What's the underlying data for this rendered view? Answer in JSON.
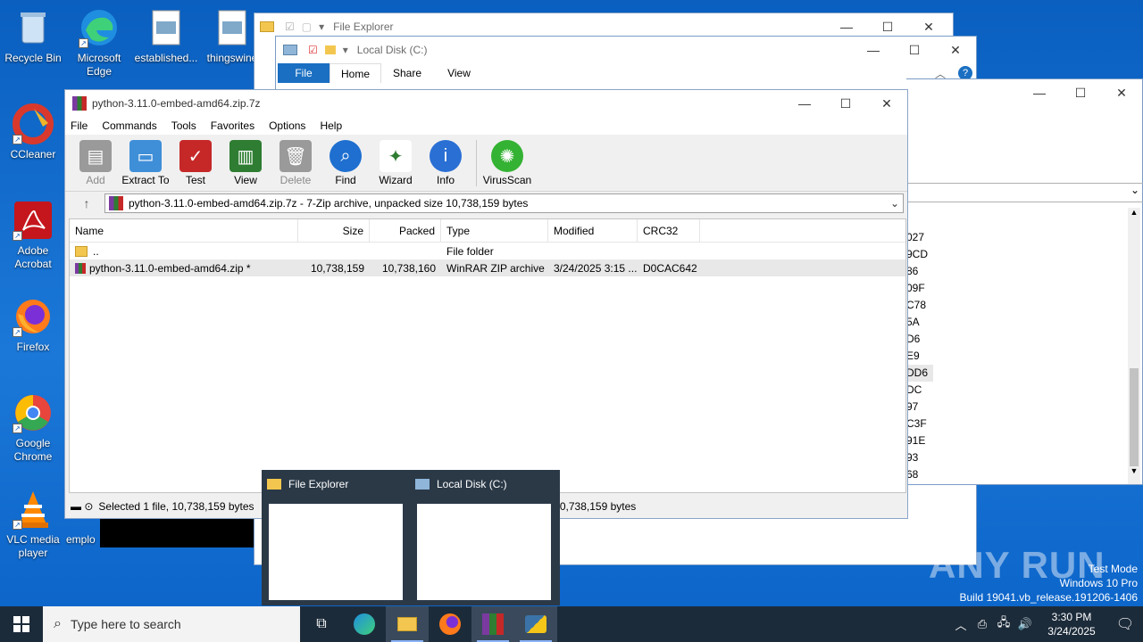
{
  "desktop": {
    "icons": [
      {
        "label": "Recycle Bin"
      },
      {
        "label": "Microsoft Edge"
      },
      {
        "label": "established..."
      },
      {
        "label": "thingswine"
      },
      {
        "label": "CCleaner"
      },
      {
        "label": "Adobe Acrobat"
      },
      {
        "label": "Firefox"
      },
      {
        "label": "Google Chrome"
      },
      {
        "label": "VLC media player"
      },
      {
        "label": "emplo"
      }
    ]
  },
  "explorer_back": {
    "title": "File Explorer"
  },
  "explorer_front": {
    "title": "Local Disk (C:)",
    "ribbon_tabs": [
      "File",
      "Home",
      "Share",
      "View"
    ],
    "partial_col": [
      "027",
      "9CD",
      "86",
      "09F",
      "C78",
      "5A",
      "D6",
      "E9",
      "DD6",
      "DC",
      "97",
      "C3F",
      "91E",
      "93",
      "68"
    ]
  },
  "winrar": {
    "title": "python-3.11.0-embed-amd64.zip.7z",
    "menu": [
      "File",
      "Commands",
      "Tools",
      "Favorites",
      "Options",
      "Help"
    ],
    "toolbar": [
      {
        "label": "Add",
        "disabled": true
      },
      {
        "label": "Extract To"
      },
      {
        "label": "Test"
      },
      {
        "label": "View"
      },
      {
        "label": "Delete",
        "disabled": true
      },
      {
        "label": "Find"
      },
      {
        "label": "Wizard"
      },
      {
        "label": "Info"
      },
      {
        "label": "VirusScan"
      }
    ],
    "path": "python-3.11.0-embed-amd64.zip.7z - 7-Zip archive, unpacked size 10,738,159 bytes",
    "columns": [
      "Name",
      "Size",
      "Packed",
      "Type",
      "Modified",
      "CRC32"
    ],
    "rows": [
      {
        "name": "..",
        "size": "",
        "packed": "",
        "type": "File folder",
        "modified": "",
        "crc": ""
      },
      {
        "name": "python-3.11.0-embed-amd64.zip *",
        "size": "10,738,159",
        "packed": "10,738,160",
        "type": "WinRAR ZIP archive",
        "modified": "3/24/2025 3:15 ...",
        "crc": "D0CAC642"
      }
    ],
    "status_left": "Selected 1 file, 10,738,159 bytes",
    "status_right": ", 10,738,159 bytes"
  },
  "thumbnails": [
    {
      "title": "File Explorer"
    },
    {
      "title": "Local Disk (C:)"
    }
  ],
  "watermark": {
    "brand": "ANY RUN",
    "line1": "Test Mode",
    "line2": "Windows 10 Pro",
    "line3": "Build 19041.vb_release.191206-1406"
  },
  "taskbar": {
    "search_placeholder": "Type here to search",
    "time": "3:30 PM",
    "date": "3/24/2025"
  }
}
